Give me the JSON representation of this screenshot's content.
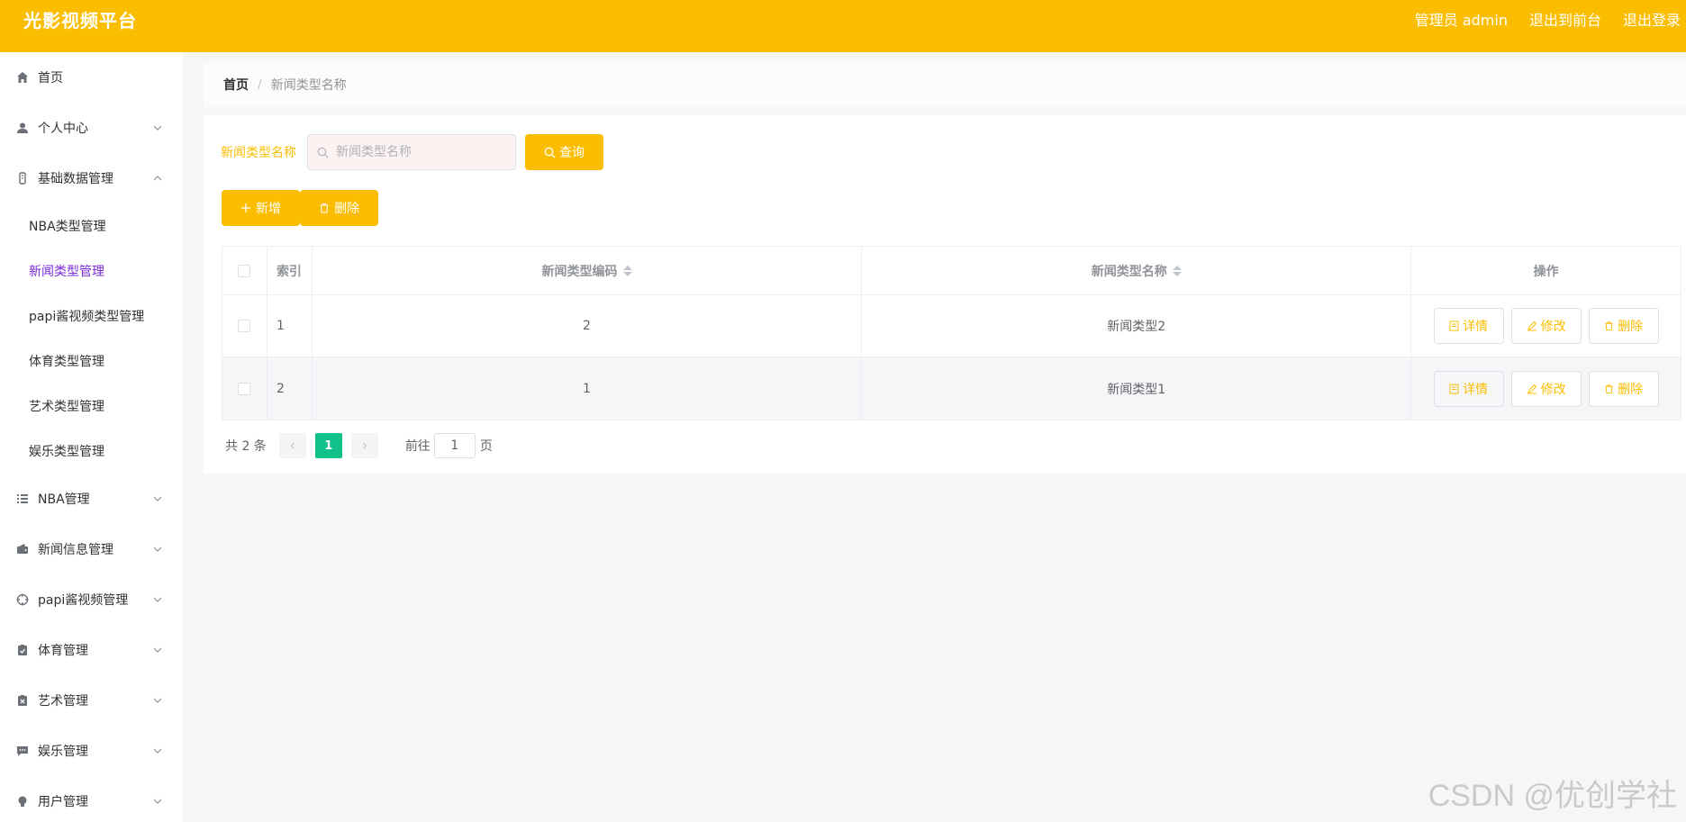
{
  "header": {
    "brand": "光影视频平台",
    "user_label": "管理员 admin",
    "to_front_label": "退出到前台",
    "logout_label": "退出登录",
    "bg_color": "#fbbd00"
  },
  "sidebar": {
    "items": [
      {
        "label": "首页",
        "icon": "home-icon"
      },
      {
        "label": "个人中心",
        "icon": "user-icon"
      },
      {
        "label": "基础数据管理",
        "icon": "data-icon",
        "expanded": true,
        "children": [
          "NBA类型管理",
          "新闻类型管理",
          "papi酱视频类型管理",
          "体育类型管理",
          "艺术类型管理",
          "娱乐类型管理"
        ],
        "active_child": "新闻类型管理"
      },
      {
        "label": "NBA管理",
        "icon": "list-icon"
      },
      {
        "label": "新闻信息管理",
        "icon": "wallet-icon"
      },
      {
        "label": "papi酱视频管理",
        "icon": "aim-icon"
      },
      {
        "label": "体育管理",
        "icon": "clipboard-check-icon"
      },
      {
        "label": "艺术管理",
        "icon": "clipboard-x-icon"
      },
      {
        "label": "娱乐管理",
        "icon": "chat-icon"
      },
      {
        "label": "用户管理",
        "icon": "bulb-icon"
      }
    ]
  },
  "breadcrumb": {
    "home": "首页",
    "separator": "/",
    "current": "新闻类型名称"
  },
  "search": {
    "label": "新闻类型名称",
    "placeholder": "新闻类型名称",
    "button": "查询"
  },
  "actions": {
    "add": "新增",
    "delete": "删除"
  },
  "table": {
    "columns": [
      "索引",
      "新闻类型编码",
      "新闻类型名称",
      "操作"
    ],
    "rows": [
      {
        "index": "1",
        "code": "2",
        "name": "新闻类型2"
      },
      {
        "index": "2",
        "code": "1",
        "name": "新闻类型1"
      }
    ],
    "ops": {
      "detail": "详情",
      "edit": "修改",
      "delete": "删除"
    }
  },
  "pagination": {
    "total_text": "共 2 条",
    "current_page": "1",
    "goto_label": "前往",
    "goto_value": "1",
    "page_label": "页"
  },
  "watermark": "CSDN @优创学社"
}
